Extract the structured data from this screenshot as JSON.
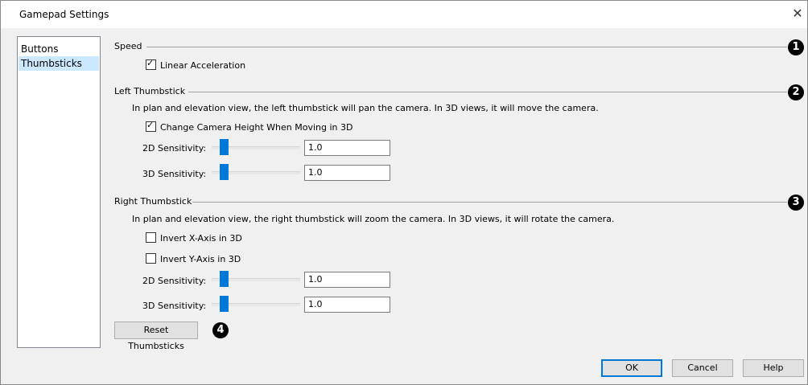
{
  "window": {
    "title": "Gamepad Settings",
    "close_glyph": "✕"
  },
  "sidebar": {
    "items": [
      {
        "label": "Buttons"
      },
      {
        "label": "Thumbsticks"
      }
    ]
  },
  "speed": {
    "label": "Speed",
    "marker": "1",
    "linear_acceleration": {
      "label": "Linear Acceleration",
      "checked": true
    }
  },
  "left": {
    "label": "Left Thumbstick",
    "marker": "2",
    "description": "In plan and elevation view, the left thumbstick will pan the camera. In 3D views, it will move the camera.",
    "change_height": {
      "label": "Change Camera Height When Moving in 3D",
      "checked": true
    },
    "sens2d": {
      "label": "2D Sensitivity:",
      "value": "1.0"
    },
    "sens3d": {
      "label": "3D Sensitivity:",
      "value": "1.0"
    }
  },
  "right": {
    "label": "Right Thumbstick",
    "marker": "3",
    "description": "In plan and elevation view, the right thumbstick will zoom the camera. In 3D views, it will rotate the camera.",
    "invert_x": {
      "label": "Invert X-Axis in 3D",
      "checked": false
    },
    "invert_y": {
      "label": "Invert Y-Axis in 3D",
      "checked": false
    },
    "sens2d": {
      "label": "2D Sensitivity:",
      "value": "1.0"
    },
    "sens3d": {
      "label": "3D Sensitivity:",
      "value": "1.0"
    }
  },
  "reset": {
    "label": "Reset Thumbsticks",
    "marker": "4"
  },
  "footer": {
    "ok": "OK",
    "cancel": "Cancel",
    "help": "Help"
  },
  "colors": {
    "accent": "#0078d7",
    "selection": "#cce8ff"
  }
}
